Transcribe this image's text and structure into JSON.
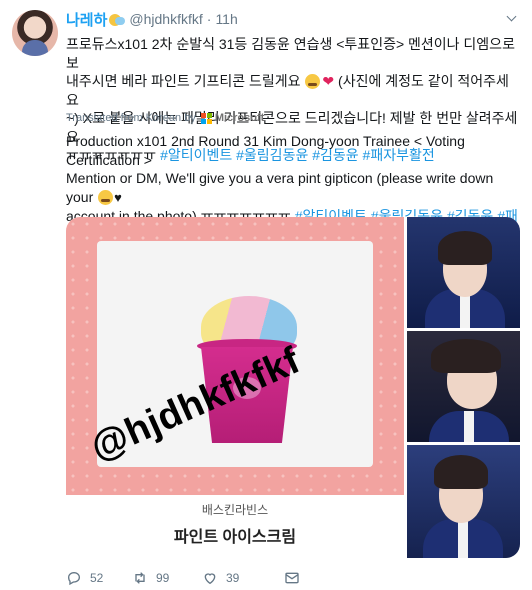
{
  "tweet": {
    "display_name": "나레하",
    "handle": "@hjdhkfkfkf",
    "time": "11h",
    "korean_lines": [
      "프로듀스x101 2차 순발식 31등 김동윤 연습생 <투표인증> 멘션이나 디엠으로 보",
      "내주시면 베라 파인트 기프티콘 드릴게요",
      "(사진에 계정도 같이 적어주세요",
      "~) X로 붙을 시에는 패밀리 기프티콘으로 드리겠습니다! 제발 한 번만 살려주세요",
      "ㅠㅠㅠㅠㅠㅠㅠ"
    ],
    "korean_hashtags": [
      "#알티이벤트",
      "#울림김동윤",
      "#김동윤",
      "#패자부활전"
    ],
    "translated_label": "Translated from Korean by",
    "translator": "Microsoft",
    "english_lines": [
      "Production x101 2nd Round 31 Kim Dong-yoon Trainee < Voting Certification >",
      "Mention or DM, We'll give you a vera pint gipticon (please write down your",
      "account in the photo).ㅠㅠㅠㅠㅠㅠㅠ"
    ],
    "english_hashtags": [
      "#알티이벤트",
      "#울림김동윤",
      "#김동윤",
      "#패자부",
      "활전"
    ]
  },
  "media": {
    "watermark": "@hjdhkfkfkf",
    "store_name": "배스킨라빈스",
    "product_name": "파인트 아이스크림"
  },
  "actions": {
    "reply_count": "52",
    "retweet_count": "99",
    "like_count": "39"
  },
  "colors": {
    "link": "#1b95e0",
    "name": "#1da1f2",
    "muted": "#657786",
    "card_pink": "#f2a3a0"
  }
}
